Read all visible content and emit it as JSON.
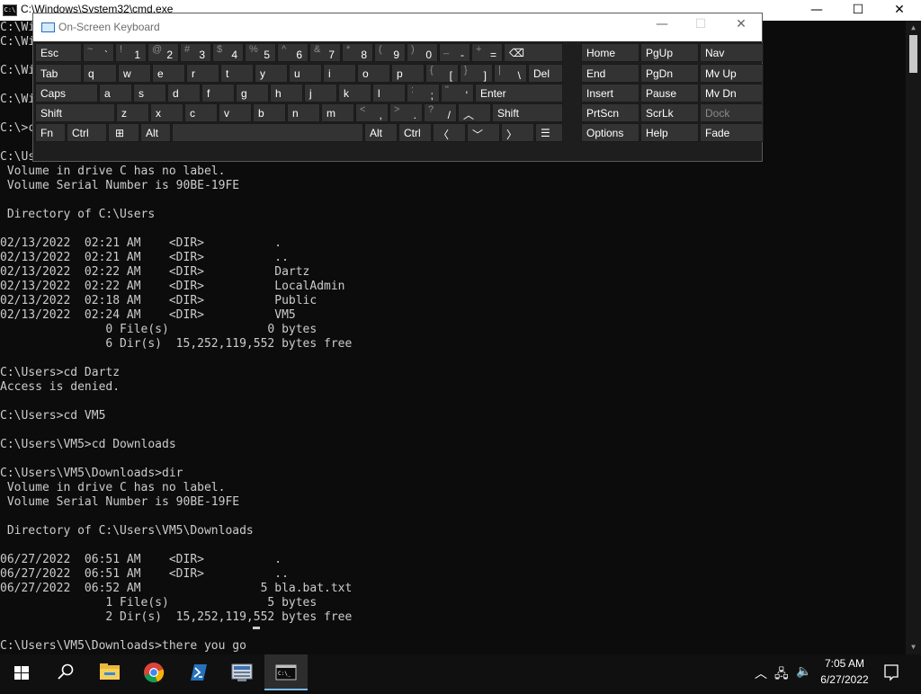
{
  "cmd_window": {
    "title": "C:\\Windows\\System32\\cmd.exe",
    "icon_text": "C:\\",
    "controls": {
      "minimize": "—",
      "maximize": "☐",
      "close": "✕"
    }
  },
  "terminal": {
    "lines": [
      "C:\\Wi",
      "C:\\Wi",
      "",
      "C:\\Wi",
      "",
      "C:\\Wi",
      "",
      "C:\\>c",
      "",
      "C:\\Use",
      " Volume in drive C has no label.",
      " Volume Serial Number is 90BE-19FE",
      "",
      " Directory of C:\\Users",
      "",
      "02/13/2022  02:21 AM    <DIR>          .",
      "02/13/2022  02:21 AM    <DIR>          ..",
      "02/13/2022  02:22 AM    <DIR>          Dartz",
      "02/13/2022  02:22 AM    <DIR>          LocalAdmin",
      "02/13/2022  02:18 AM    <DIR>          Public",
      "02/13/2022  02:24 AM    <DIR>          VM5",
      "               0 File(s)              0 bytes",
      "               6 Dir(s)  15,252,119,552 bytes free",
      "",
      "C:\\Users>cd Dartz",
      "Access is denied.",
      "",
      "C:\\Users>cd VM5",
      "",
      "C:\\Users\\VM5>cd Downloads",
      "",
      "C:\\Users\\VM5\\Downloads>dir",
      " Volume in drive C has no label.",
      " Volume Serial Number is 90BE-19FE",
      "",
      " Directory of C:\\Users\\VM5\\Downloads",
      "",
      "06/27/2022  06:51 AM    <DIR>          .",
      "06/27/2022  06:51 AM    <DIR>          ..",
      "06/27/2022  06:52 AM                 5 bla.bat.txt",
      "               1 File(s)              5 bytes",
      "               2 Dir(s)  15,252,119,552 bytes free",
      "",
      "C:\\Users\\VM5\\Downloads>there you go"
    ]
  },
  "osk": {
    "title": "On-Screen Keyboard",
    "controls": {
      "minimize": "—",
      "maximize": "☐",
      "close": "✕"
    },
    "rows": [
      [
        {
          "id": "esc",
          "main": "Esc"
        },
        {
          "id": "backtick",
          "shift": "~",
          "main": "`"
        },
        {
          "id": "1",
          "shift": "!",
          "main": "1"
        },
        {
          "id": "2",
          "shift": "@",
          "main": "2"
        },
        {
          "id": "3",
          "shift": "#",
          "main": "3"
        },
        {
          "id": "4",
          "shift": "$",
          "main": "4"
        },
        {
          "id": "5",
          "shift": "%",
          "main": "5"
        },
        {
          "id": "6",
          "shift": "^",
          "main": "6"
        },
        {
          "id": "7",
          "shift": "&",
          "main": "7"
        },
        {
          "id": "8",
          "shift": "*",
          "main": "8"
        },
        {
          "id": "9",
          "shift": "(",
          "main": "9"
        },
        {
          "id": "0",
          "shift": ")",
          "main": "0"
        },
        {
          "id": "minus",
          "shift": "_",
          "main": "-"
        },
        {
          "id": "equals",
          "shift": "+",
          "main": "="
        },
        {
          "id": "backspace",
          "main": "⌫"
        },
        {
          "id": "home",
          "main": "Home"
        },
        {
          "id": "pgup",
          "main": "PgUp"
        },
        {
          "id": "nav",
          "main": "Nav"
        }
      ],
      [
        {
          "id": "tab",
          "main": "Tab"
        },
        {
          "id": "q",
          "main": "q"
        },
        {
          "id": "w",
          "main": "w"
        },
        {
          "id": "e",
          "main": "e"
        },
        {
          "id": "r",
          "main": "r"
        },
        {
          "id": "t",
          "main": "t"
        },
        {
          "id": "y",
          "main": "y"
        },
        {
          "id": "u",
          "main": "u"
        },
        {
          "id": "i",
          "main": "i"
        },
        {
          "id": "o",
          "main": "o"
        },
        {
          "id": "p",
          "main": "p"
        },
        {
          "id": "lbracket",
          "shift": "{",
          "main": "["
        },
        {
          "id": "rbracket",
          "shift": "}",
          "main": "]"
        },
        {
          "id": "backslash",
          "shift": "|",
          "main": "\\"
        },
        {
          "id": "del",
          "main": "Del"
        },
        {
          "id": "end",
          "main": "End"
        },
        {
          "id": "pgdn",
          "main": "PgDn"
        },
        {
          "id": "mvup",
          "main": "Mv Up"
        }
      ],
      [
        {
          "id": "caps",
          "main": "Caps"
        },
        {
          "id": "a",
          "main": "a"
        },
        {
          "id": "s",
          "main": "s"
        },
        {
          "id": "d",
          "main": "d"
        },
        {
          "id": "f",
          "main": "f"
        },
        {
          "id": "g",
          "main": "g"
        },
        {
          "id": "h",
          "main": "h"
        },
        {
          "id": "j",
          "main": "j"
        },
        {
          "id": "k",
          "main": "k"
        },
        {
          "id": "l",
          "main": "l"
        },
        {
          "id": "semicolon",
          "shift": ":",
          "main": ";"
        },
        {
          "id": "quote",
          "shift": "\"",
          "main": "'"
        },
        {
          "id": "enter",
          "main": "Enter"
        },
        {
          "id": "insert",
          "main": "Insert"
        },
        {
          "id": "pause",
          "main": "Pause"
        },
        {
          "id": "mvdn",
          "main": "Mv Dn"
        }
      ],
      [
        {
          "id": "shift-left",
          "main": "Shift"
        },
        {
          "id": "z",
          "main": "z"
        },
        {
          "id": "x",
          "main": "x"
        },
        {
          "id": "c",
          "main": "c"
        },
        {
          "id": "v",
          "main": "v"
        },
        {
          "id": "b",
          "main": "b"
        },
        {
          "id": "n",
          "main": "n"
        },
        {
          "id": "m",
          "main": "m"
        },
        {
          "id": "comma",
          "shift": "<",
          "main": ","
        },
        {
          "id": "period",
          "shift": ">",
          "main": "."
        },
        {
          "id": "slash",
          "shift": "?",
          "main": "/"
        },
        {
          "id": "arrow-up",
          "main": "︿"
        },
        {
          "id": "shift-right",
          "main": "Shift"
        },
        {
          "id": "prtscn",
          "main": "PrtScn"
        },
        {
          "id": "scrlk",
          "main": "ScrLk"
        },
        {
          "id": "dock",
          "main": "Dock"
        }
      ],
      [
        {
          "id": "fn",
          "main": "Fn"
        },
        {
          "id": "ctrl-left",
          "main": "Ctrl"
        },
        {
          "id": "win",
          "main": "⊞"
        },
        {
          "id": "alt-left",
          "main": "Alt"
        },
        {
          "id": "space",
          "main": ""
        },
        {
          "id": "alt-right",
          "main": "Alt"
        },
        {
          "id": "ctrl-right",
          "main": "Ctrl"
        },
        {
          "id": "arrow-left",
          "main": "〈"
        },
        {
          "id": "arrow-down",
          "main": "﹀"
        },
        {
          "id": "arrow-right",
          "main": "〉"
        },
        {
          "id": "menu",
          "main": "☰"
        },
        {
          "id": "options",
          "main": "Options"
        },
        {
          "id": "help",
          "main": "Help"
        },
        {
          "id": "fade",
          "main": "Fade"
        }
      ]
    ]
  },
  "taskbar": {
    "apps": [
      {
        "id": "start",
        "icon": "windows-logo-icon"
      },
      {
        "id": "search",
        "icon": "search-icon"
      },
      {
        "id": "explorer",
        "icon": "file-explorer-icon"
      },
      {
        "id": "chrome",
        "icon": "chrome-icon"
      },
      {
        "id": "powershell",
        "icon": "powershell-icon"
      },
      {
        "id": "server",
        "icon": "server-manager-icon"
      },
      {
        "id": "cmd",
        "icon": "command-prompt-icon"
      }
    ],
    "tray": {
      "chevron": "︿",
      "network": "🖧",
      "volume": "🔈",
      "time": "7:05 AM",
      "date": "6/27/2022"
    },
    "accent": "#76b9ed"
  }
}
